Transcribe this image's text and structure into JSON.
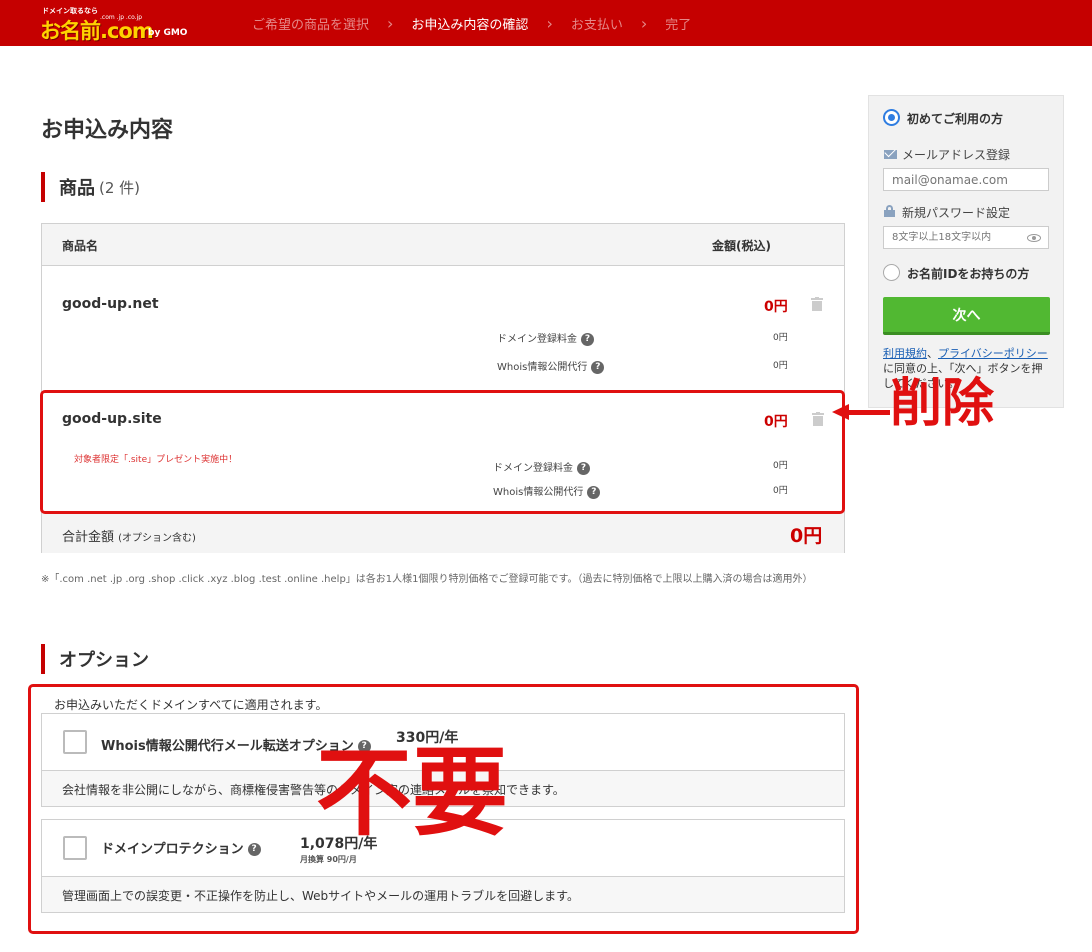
{
  "header": {
    "logo_tag": "ドメイン取るなら",
    "logo_main": "お名前.com",
    "logo_tlds": ".com .jp .co.jp",
    "logo_gmo": "by GMO",
    "steps": [
      {
        "label": "ご希望の商品を選択",
        "active": false
      },
      {
        "label": "お申込み内容の確認",
        "active": true
      },
      {
        "label": "お支払い",
        "active": false
      },
      {
        "label": "完了",
        "active": false
      }
    ]
  },
  "page_title": "お申込み内容",
  "products_section": {
    "title": "商品",
    "count": "(2 件)",
    "col_name": "商品名",
    "col_price": "金額(税込)",
    "items": [
      {
        "name": "good-up.net",
        "price": "0円",
        "promo": "",
        "fees": [
          {
            "label": "ドメイン登録料金",
            "value": "0円"
          },
          {
            "label": "Whois情報公開代行",
            "value": "0円"
          }
        ]
      },
      {
        "name": "good-up.site",
        "price": "0円",
        "promo": "対象者限定「.site」プレゼント実施中！",
        "fees": [
          {
            "label": "ドメイン登録料金",
            "value": "0円"
          },
          {
            "label": "Whois情報公開代行",
            "value": "0円"
          }
        ]
      }
    ],
    "total_label": "合計金額",
    "total_sub": "(オプション含む)",
    "total_value": "0円"
  },
  "note": "※「.com .net .jp .org .shop .click .xyz .blog .test .online .help」は各お1人様1個限り特別価格でご登録可能です。（過去に特別価格で上限以上購入済の場合は適用外）",
  "options_section": {
    "title": "オプション",
    "intro": "お申込みいただくドメインすべてに適用されます。",
    "options": [
      {
        "name": "Whois情報公開代行メール転送オプション",
        "price": "330円/年",
        "sub": "",
        "desc": "会社情報を非公開にしながら、商標権侵害警告等のドメイン宛の連絡メールを察知できます。",
        "checked": false
      },
      {
        "name": "ドメインプロテクション",
        "price": "1,078円/年",
        "sub": "月換算 90円/月",
        "desc": "管理画面上での誤変更・不正操作を防止し、Webサイトやメールの運用トラブルを回避します。",
        "checked": false
      }
    ]
  },
  "sidebar": {
    "new_user_label": "初めてご利用の方",
    "email_label": "メールアドレス登録",
    "email_placeholder": "mail@onamae.com",
    "password_label": "新規パスワード設定",
    "password_placeholder": "8文字以上18文字以内",
    "existing_user_label": "お名前IDをお持ちの方",
    "next_button": "次へ",
    "terms_link1": "利用規約",
    "terms_sep": "、",
    "terms_link2": "プライバシーポリシー",
    "terms_text": "に同意の上、「次へ」ボタンを押してください。"
  },
  "annotations": {
    "delete_label": "削除",
    "unneeded_label": "不要"
  },
  "colors": {
    "brand_red": "#c50000",
    "price_red": "#cc0000",
    "annotation_red": "#e01010",
    "next_green": "#51b832",
    "radio_blue": "#2f7de1"
  },
  "icons": [
    "trash-icon",
    "help-icon",
    "mail-icon",
    "lock-icon",
    "eye-icon",
    "chevron-right-icon"
  ]
}
